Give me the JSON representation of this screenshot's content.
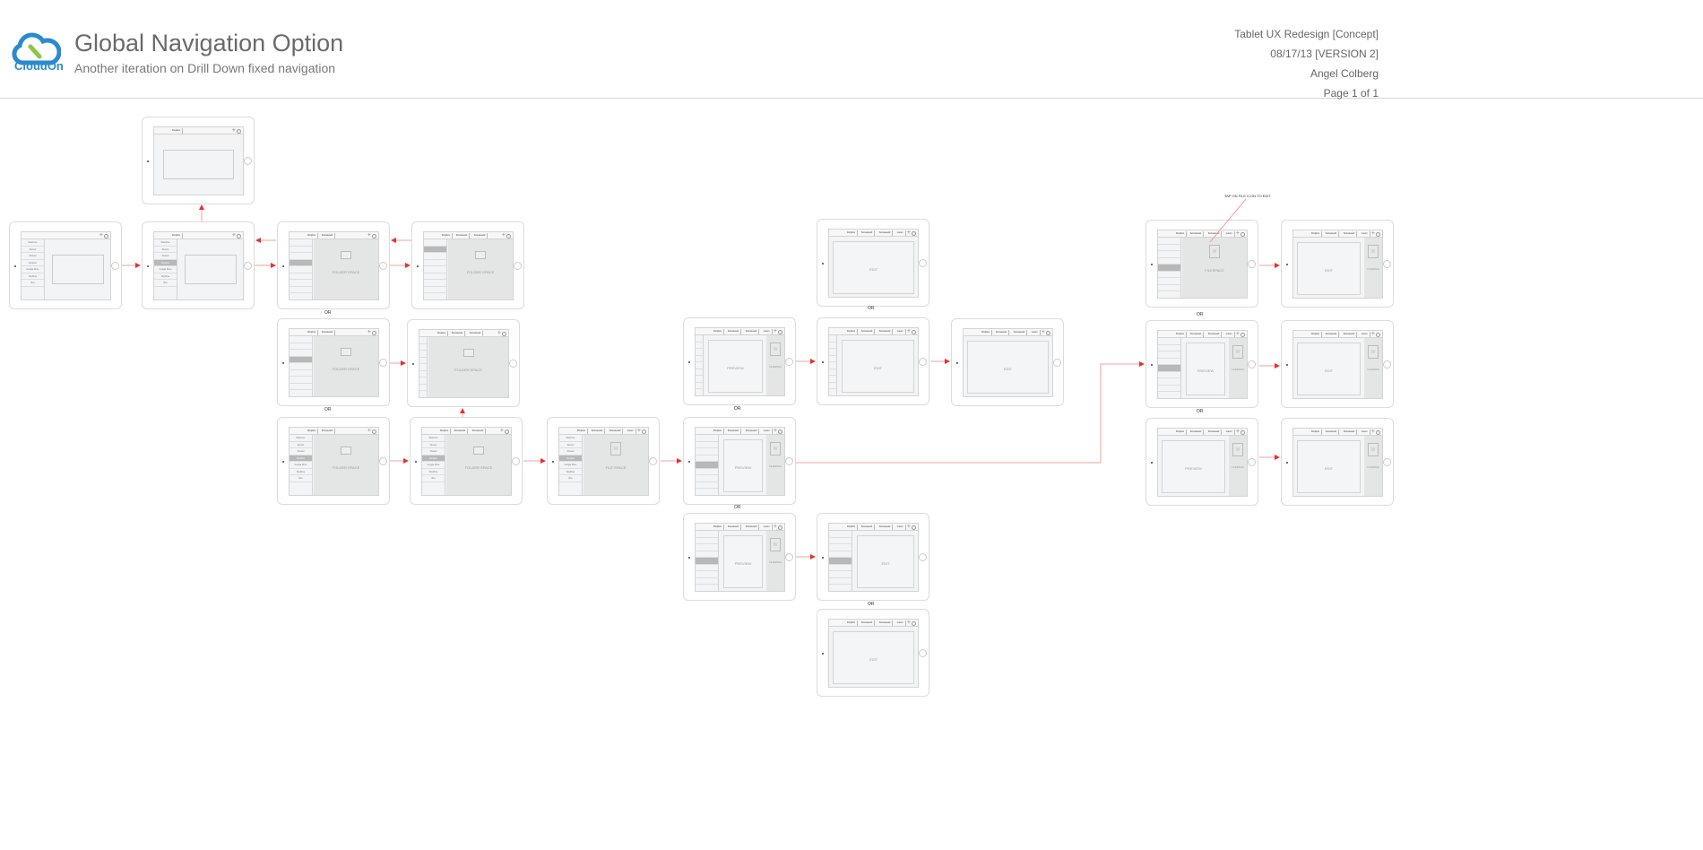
{
  "header": {
    "logo_text": "CloudOn",
    "title": "Global Navigation Option",
    "subtitle": "Another iteration on Drill Down fixed navigation",
    "meta": [
      "Tablet UX Redesign [Concept]",
      "08/17/13 [VERSION 2]",
      "Angel Colberg",
      "Page 1 of 1"
    ]
  },
  "colors": {
    "accent": "#e8312f",
    "logo_blue": "#2a8ad0",
    "logo_green": "#8cc63f",
    "wire_grey": "#e4e5e5"
  },
  "menu": [
    "Welcome",
    "Recent",
    "Shared",
    "Dropbox",
    "Google Drive",
    "SkyDrive",
    "Box"
  ],
  "annotation": "TAP ON FILE ICON TO EDIT",
  "or_label": "OR",
  "screens": [
    {
      "crumbs": [],
      "side": "menu",
      "hl": -1,
      "main": "image",
      "label": ""
    },
    {
      "crumbs": [
        "Dropbox"
      ],
      "side": "menu",
      "hl": 3,
      "main": "image",
      "label": ""
    },
    {
      "crumbs": [
        "Dropbox"
      ],
      "side": "none",
      "hl": -1,
      "main": "image",
      "label": ""
    },
    {
      "crumbs": [
        "Dropbox",
        "Somelevel1"
      ],
      "side": "folder",
      "hl": 3,
      "main": "folder",
      "label": "FOLDER SPACE"
    },
    {
      "crumbs": [
        "Dropbox",
        "Somelevel1",
        "Somelevel2"
      ],
      "side": "folder",
      "hl": 1,
      "main": "folder",
      "label": "FOLDER SPACE"
    },
    {
      "crumbs": [
        "Dropbox",
        "Somelevel1"
      ],
      "side": "folder",
      "hl": 3,
      "main": "folder",
      "label": "FOLDER SPACE"
    },
    {
      "crumbs": [
        "Dropbox",
        "Somelevel1",
        "Somelevel2"
      ],
      "side": "icons",
      "hl": -1,
      "main": "folder",
      "label": "FOLDER SPACE"
    },
    {
      "crumbs": [
        "Dropbox",
        "Somelevel1"
      ],
      "side": "menu",
      "hl": 3,
      "main": "folder",
      "label": "FOLDER SPACE"
    },
    {
      "crumbs": [
        "Dropbox",
        "Somelevel1",
        "Somelevel2"
      ],
      "side": "menu",
      "hl": 3,
      "main": "folder",
      "label": "FOLDER SPACE"
    },
    {
      "crumbs": [
        "Dropbox",
        "Somelevel1",
        "Somelevel2",
        "Lorem"
      ],
      "side": "menu",
      "hl": 3,
      "main": "file",
      "label": "FILE SPACE"
    },
    {
      "crumbs": [
        "Dropbox",
        "Somelevel1",
        "Somelevel2",
        "Lorem"
      ],
      "side": "folder",
      "hl": 4,
      "main": "preview",
      "label": "PREVIEW",
      "right": "FILESPACE"
    },
    {
      "crumbs": [
        "Dropbox",
        "Somelevel1",
        "Somelevel2",
        "Lorem"
      ],
      "side": "icons",
      "hl": -1,
      "main": "preview",
      "label": "PREVIEW",
      "right": "FILESPACE"
    },
    {
      "crumbs": [
        "Dropbox",
        "Somelevel1",
        "Somelevel2",
        "Lorem"
      ],
      "side": "none",
      "hl": -1,
      "main": "edit",
      "label": "EDIT"
    },
    {
      "crumbs": [
        "Dropbox",
        "Somelevel1",
        "Somelevel2",
        "Lorem"
      ],
      "side": "icons",
      "hl": -1,
      "main": "edit",
      "label": "EDIT"
    },
    {
      "crumbs": [
        "Dropbox",
        "Somelevel1",
        "Somelevel2",
        "Lorem"
      ],
      "side": "none",
      "hl": -1,
      "main": "edit",
      "label": "EDIT"
    },
    {
      "crumbs": [
        "Dropbox",
        "Somelevel1",
        "Somelevel2",
        "Lorem"
      ],
      "side": "folder",
      "hl": 4,
      "main": "preview",
      "label": "PREVIEW",
      "right": "FILESPACE"
    },
    {
      "crumbs": [
        "Dropbox",
        "Somelevel1",
        "Somelevel2",
        "Lorem"
      ],
      "side": "folder",
      "hl": 4,
      "main": "edit",
      "label": "EDIT"
    },
    {
      "crumbs": [
        "Dropbox",
        "Somelevel1",
        "Somelevel2",
        "Lorem"
      ],
      "side": "none",
      "hl": -1,
      "main": "edit",
      "label": "EDIT"
    },
    {
      "crumbs": [
        "Dropbox",
        "Somelevel1",
        "Somelevel2",
        "Lorem"
      ],
      "side": "folder",
      "hl": 4,
      "main": "file",
      "label": "FILESPACE"
    },
    {
      "crumbs": [
        "Dropbox",
        "Somelevel1",
        "Somelevel2",
        "Lorem"
      ],
      "side": "none",
      "hl": -1,
      "main": "edit",
      "label": "EDIT",
      "right": "FILESPACE"
    },
    {
      "crumbs": [
        "Dropbox",
        "Somelevel1",
        "Somelevel2",
        "Lorem"
      ],
      "side": "folder",
      "hl": 4,
      "main": "preview",
      "label": "PREVIEW",
      "right": "FILESPACE"
    },
    {
      "crumbs": [
        "Dropbox",
        "Somelevel1",
        "Somelevel2",
        "Lorem"
      ],
      "side": "none",
      "hl": -1,
      "main": "edit",
      "label": "EDIT",
      "right": "FILESPACE"
    },
    {
      "crumbs": [
        "Dropbox",
        "Somelevel1",
        "Somelevel2",
        "Lorem"
      ],
      "side": "none",
      "hl": -1,
      "main": "preview",
      "label": "PREVIEW",
      "right": "FILESPACE"
    },
    {
      "crumbs": [
        "Dropbox",
        "Somelevel1",
        "Somelevel2",
        "Lorem"
      ],
      "side": "none",
      "hl": -1,
      "main": "edit",
      "label": "EDIT",
      "right": "FILESPACE"
    }
  ]
}
